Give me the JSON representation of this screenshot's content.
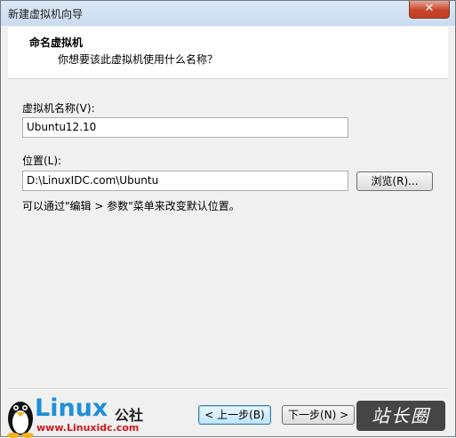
{
  "window": {
    "title": "新建虚拟机向导",
    "close_glyph": "✕"
  },
  "header": {
    "title": "命名虚拟机",
    "subtitle": "你想要该此虚拟机使用什么名称？"
  },
  "form": {
    "name_label": "虚拟机名称(V):",
    "name_value": "Ubuntu12.10",
    "location_label": "位置(L):",
    "location_value": "D:\\LinuxIDC.com\\Ubuntu",
    "browse_label": "浏览(R)...",
    "hint": "可以通过\"编辑 > 参数\"菜单来改变默认位置。"
  },
  "buttons": {
    "back_label": "< 上一步(B)",
    "next_label": "下一步(N) >"
  },
  "branding": {
    "logo_text": "Linux",
    "logo_cn": "公社",
    "logo_url": "www.Linuxidc.com",
    "watermark": "站长圈"
  },
  "colors": {
    "logo_blue": "#1f8fd8",
    "logo_red": "#d0171b",
    "close_red": "#c7442b"
  }
}
